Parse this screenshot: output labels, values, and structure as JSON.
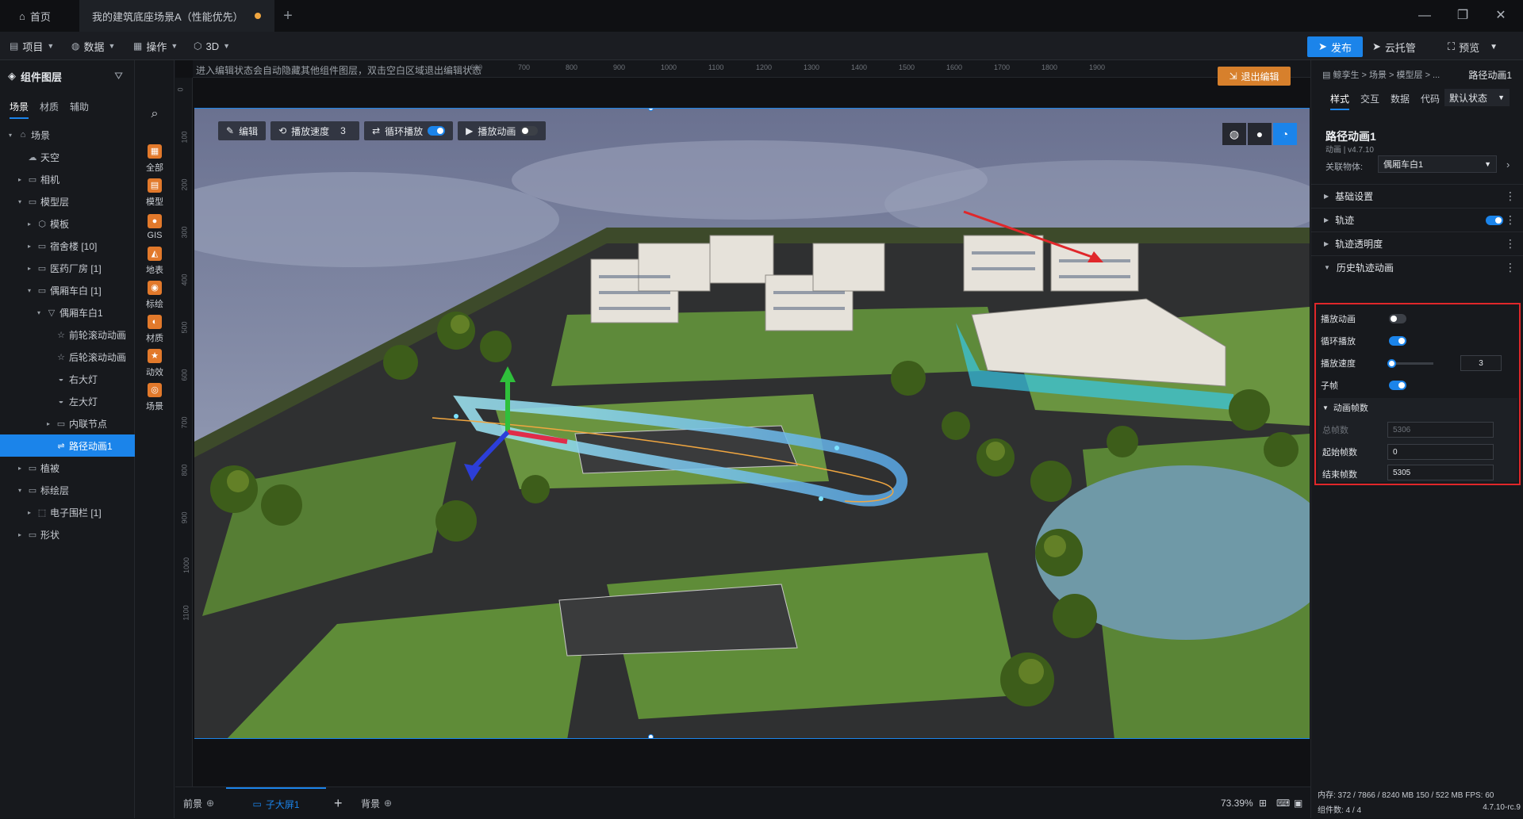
{
  "tabs": {
    "home": "首页",
    "scene": "我的建筑底座场景A（性能优先）"
  },
  "menu": {
    "project": "项目",
    "data": "数据",
    "operate": "操作",
    "threeD": "3D"
  },
  "actions": {
    "publish": "发布",
    "cloud": "云托管",
    "preview": "预览"
  },
  "left": {
    "title": "组件图层",
    "tabs": [
      "场景",
      "材质",
      "辅助"
    ],
    "tree": [
      {
        "label": "场景",
        "depth": 0,
        "arrow": "▾",
        "icon": "⌂"
      },
      {
        "label": "天空",
        "depth": 1,
        "arrow": "",
        "icon": "☁"
      },
      {
        "label": "相机",
        "depth": 1,
        "arrow": "▸",
        "icon": "▭"
      },
      {
        "label": "模型层",
        "depth": 1,
        "arrow": "▾",
        "icon": "▭"
      },
      {
        "label": "模板",
        "depth": 2,
        "arrow": "▸",
        "icon": "⬡"
      },
      {
        "label": "宿舍楼 [10]",
        "depth": 2,
        "arrow": "▸",
        "icon": "▭"
      },
      {
        "label": "医药厂房 [1]",
        "depth": 2,
        "arrow": "▸",
        "icon": "▭"
      },
      {
        "label": "偶厢车白 [1]",
        "depth": 2,
        "arrow": "▾",
        "icon": "▭"
      },
      {
        "label": "偶厢车白1",
        "depth": 3,
        "arrow": "▾",
        "icon": "▽"
      },
      {
        "label": "前轮滚动动画",
        "depth": 4,
        "arrow": "",
        "icon": "☆"
      },
      {
        "label": "后轮滚动动画",
        "depth": 4,
        "arrow": "",
        "icon": "☆"
      },
      {
        "label": "右大灯",
        "depth": 4,
        "arrow": "",
        "icon": "◒"
      },
      {
        "label": "左大灯",
        "depth": 4,
        "arrow": "",
        "icon": "◒"
      },
      {
        "label": "内联节点",
        "depth": 4,
        "arrow": "▸",
        "icon": "▭"
      },
      {
        "label": "路径动画1",
        "depth": 4,
        "arrow": "",
        "icon": "⇌",
        "selected": true
      },
      {
        "label": "植被",
        "depth": 1,
        "arrow": "▸",
        "icon": "▭"
      },
      {
        "label": "标绘层",
        "depth": 1,
        "arrow": "▾",
        "icon": "▭"
      },
      {
        "label": "电子围栏 [1]",
        "depth": 2,
        "arrow": "▸",
        "icon": "⬚"
      },
      {
        "label": "形状",
        "depth": 1,
        "arrow": "▸",
        "icon": "▭"
      }
    ]
  },
  "tools": [
    {
      "label": "全部",
      "color": "#e2792b",
      "glyph": "▦"
    },
    {
      "label": "模型",
      "color": "#e2792b",
      "glyph": "▤"
    },
    {
      "label": "GIS",
      "color": "#e2792b",
      "glyph": "●"
    },
    {
      "label": "地表",
      "color": "#e2792b",
      "glyph": "◭"
    },
    {
      "label": "标绘",
      "color": "#e2792b",
      "glyph": "◉"
    },
    {
      "label": "材质",
      "color": "#e2792b",
      "glyph": "◐"
    },
    {
      "label": "动效",
      "color": "#e2792b",
      "glyph": "★"
    },
    {
      "label": "场景",
      "color": "#e2792b",
      "glyph": "◎"
    }
  ],
  "canvas": {
    "hint": "进入编辑状态会自动隐藏其他组件图层，双击空白区域退出编辑状态",
    "exit_edit": "退出编辑",
    "ruler_top": [
      "600",
      "700",
      "800",
      "900",
      "1000",
      "1100",
      "1200",
      "1300",
      "1400",
      "1500",
      "1600",
      "1700",
      "1800",
      "1900"
    ],
    "ruler_left": [
      "0",
      "100",
      "200",
      "300",
      "400",
      "500",
      "600",
      "700",
      "800",
      "900",
      "1000",
      "1100"
    ],
    "toolbar": {
      "edit": "编辑",
      "speed_label": "播放速度",
      "speed_value": "3",
      "loop": "循环播放",
      "play": "播放动画"
    }
  },
  "bottom": {
    "front": "前景",
    "screen": "子大屏1",
    "back": "背景",
    "zoom": "73.39%"
  },
  "right": {
    "breadcrumb": "鲸孪生 > 场景 > 模型层 > ...",
    "current": "路径动画1",
    "tabs": [
      "样式",
      "交互",
      "数据",
      "代码"
    ],
    "state": "默认状态",
    "title": "路径动画1",
    "subtitle": "动画 | v4.7.10",
    "rel_label": "关联物体:",
    "rel_value": "偶厢车白1",
    "sections": [
      "基础设置",
      "轨迹",
      "轨迹透明度",
      "历史轨迹动画"
    ],
    "props": {
      "play": "播放动画",
      "loop": "循环播放",
      "speed": "播放速度",
      "speed_value": "3",
      "subframe": "子帧",
      "frames_header": "动画帧数",
      "total": "总帧数",
      "total_value": "5306",
      "start": "起始帧数",
      "start_value": "0",
      "end": "结束帧数",
      "end_value": "5305"
    },
    "status1": "内存: 372 / 7866 / 8240 MB  150 / 522 MB  FPS: 60",
    "status2_left": "组件数: 4 / 4",
    "status2_right": "4.7.10-rc.9"
  }
}
